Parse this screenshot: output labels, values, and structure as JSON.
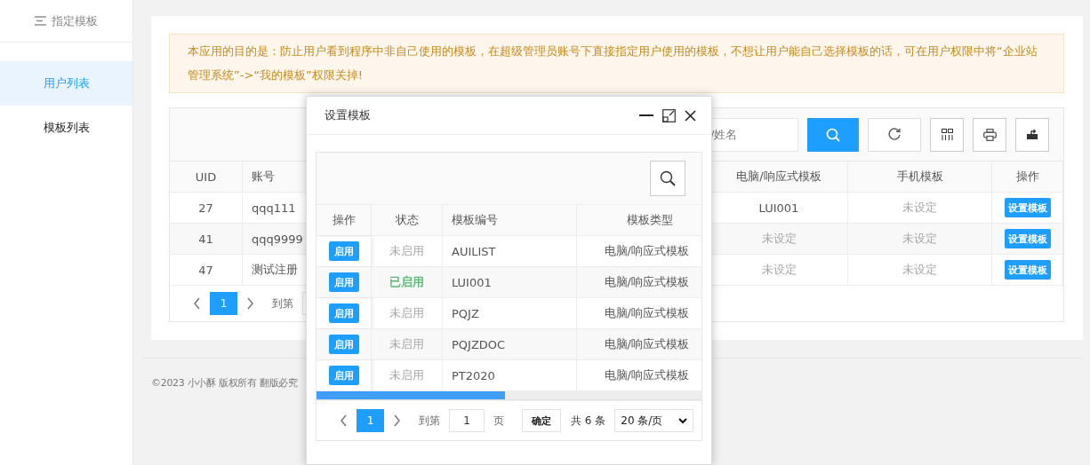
{
  "sidebar": {
    "title": "指定模板",
    "items": [
      {
        "label": "用户列表",
        "selected": true
      },
      {
        "label": "模板列表",
        "selected": false
      }
    ]
  },
  "notice": "本应用的目的是：防止用户看到程序中非自己使用的模板，在超级管理员账号下直接指定用户使用的模板，不想让用户能自己选择模板的话，可在用户权限中将“企业站管理系统”->“我的模板”权限关掉!",
  "user_table": {
    "search": {
      "placeholder": "/姓名"
    },
    "columns": [
      "UID",
      "账号",
      "电脑/响应式模板",
      "手机模板",
      "操作"
    ],
    "rows": [
      {
        "uid": "27",
        "account": "qqq111",
        "pc_template": {
          "text": "LUI001",
          "set": true
        },
        "mobile_template": {
          "text": "未设定",
          "set": false
        },
        "action": "设置模板"
      },
      {
        "uid": "41",
        "account": "qqq9999",
        "pc_template": {
          "text": "未设定",
          "set": false
        },
        "mobile_template": {
          "text": "未设定",
          "set": false
        },
        "action": "设置模板"
      },
      {
        "uid": "47",
        "account": "测试注册",
        "pc_template": {
          "text": "未设定",
          "set": false
        },
        "mobile_template": {
          "text": "未设定",
          "set": false
        },
        "action": "设置模板"
      }
    ],
    "pagination": {
      "pages": [
        {
          "label": "1",
          "selected": true
        }
      ],
      "goto_label": "到第"
    }
  },
  "footer": "©2023 小小酥 版权所有 翻版必究",
  "dialog": {
    "title": "设置模板",
    "columns": [
      "操作",
      "状态",
      "模板编号",
      "模板类型"
    ],
    "rows": [
      {
        "action": "启用",
        "status": "未启用",
        "enabled": false,
        "code": "AUILIST",
        "type": "电脑/响应式模板"
      },
      {
        "action": "启用",
        "status": "已启用",
        "enabled": true,
        "code": "LUI001",
        "type": "电脑/响应式模板"
      },
      {
        "action": "启用",
        "status": "未启用",
        "enabled": false,
        "code": "PQJZ",
        "type": "电脑/响应式模板"
      },
      {
        "action": "启用",
        "status": "未启用",
        "enabled": false,
        "code": "PQJZDOC",
        "type": "电脑/响应式模板"
      },
      {
        "action": "启用",
        "status": "未启用",
        "enabled": false,
        "code": "PT2020",
        "type": "电脑/响应式模板"
      }
    ],
    "pagination": {
      "pages": [
        {
          "label": "1",
          "selected": true
        }
      ],
      "goto_label": "到第",
      "page_input": "1",
      "page_unit": "页",
      "confirm": "确定",
      "total": "共 6 条",
      "page_size": "20 条/页"
    }
  }
}
